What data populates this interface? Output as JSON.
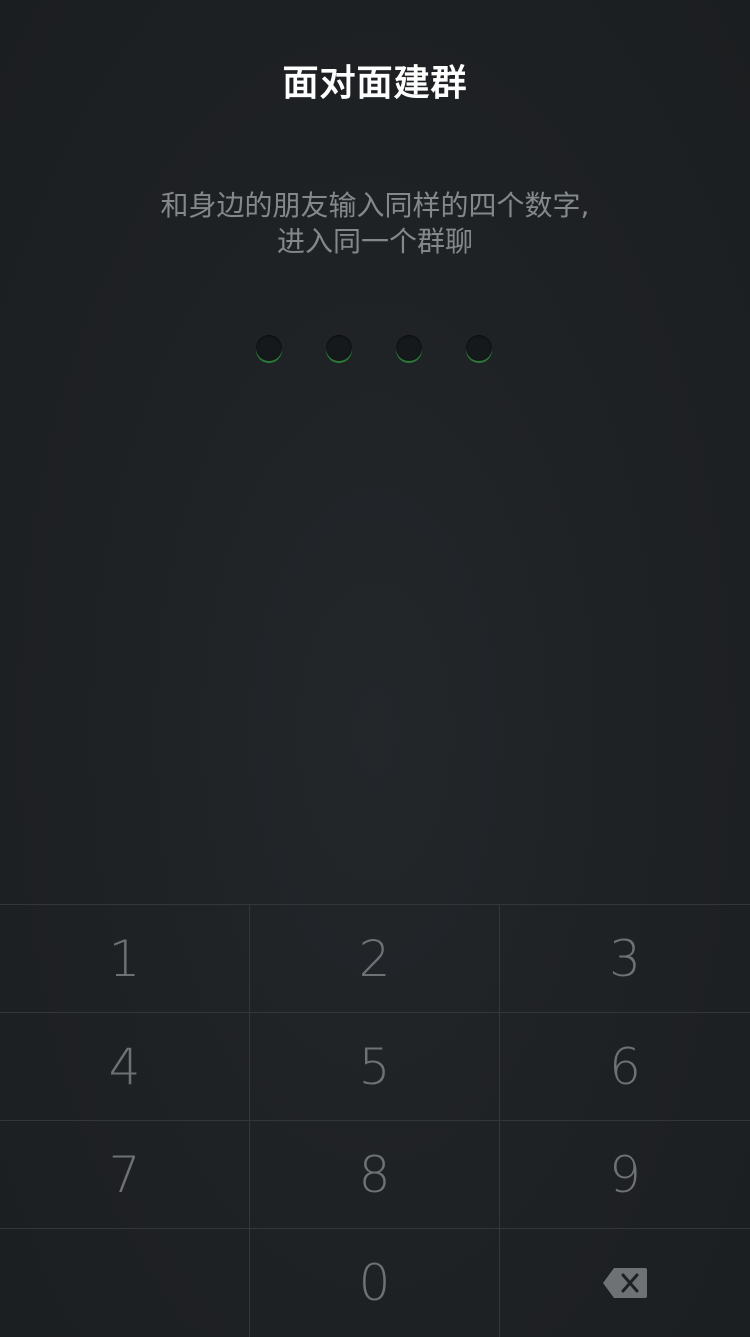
{
  "header": {
    "title": "面对面建群"
  },
  "instructions": {
    "line1": "和身边的朋友输入同样的四个数字,",
    "line2": "进入同一个群聊"
  },
  "pin": {
    "length": 4,
    "entered": 0,
    "accent_color": "#2a7a38"
  },
  "keypad": {
    "rows": [
      [
        "1",
        "2",
        "3"
      ],
      [
        "4",
        "5",
        "6"
      ],
      [
        "7",
        "8",
        "9"
      ],
      [
        "",
        "0",
        "backspace-icon"
      ]
    ]
  },
  "colors": {
    "background": "#1f2225",
    "title": "#ffffff",
    "subtitle": "#85888b",
    "key_text": "#6e7275",
    "divider": "#33373a"
  }
}
